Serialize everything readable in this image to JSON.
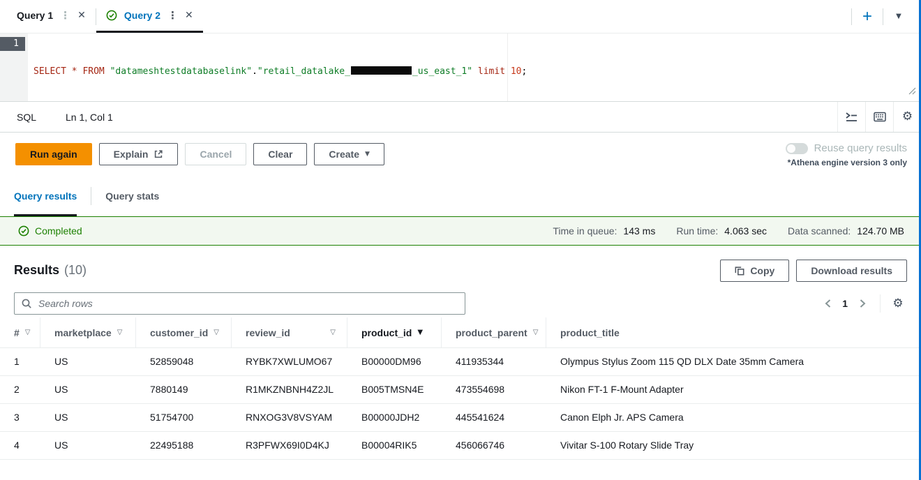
{
  "icons": {
    "kebab": "⋮",
    "close": "✕",
    "plus": "+",
    "caret_down": "▼",
    "gear": "⚙",
    "sort": "▽",
    "sort_active": "▼"
  },
  "colors": {
    "accent_blue": "#0073bb",
    "run_button_orange": "#f49000",
    "success_green": "#1d8102",
    "banner_background": "#f2f8f0",
    "panel_edge_blue": "#0972d3"
  },
  "query_tabs": [
    {
      "label": "Query 1",
      "active": false
    },
    {
      "label": "Query 2",
      "active": true,
      "status": "completed"
    }
  ],
  "editor": {
    "line_number": "1",
    "sql_segments": [
      {
        "text": "SELECT * FROM ",
        "type": "keyword"
      },
      {
        "text": "\"datameshtestdatabaselink\"",
        "type": "string"
      },
      {
        "text": ".",
        "type": "plain"
      },
      {
        "text": "\"retail_datalake_",
        "type": "string"
      },
      {
        "text": "",
        "type": "redacted"
      },
      {
        "text": "_us_east_1\"",
        "type": "string"
      },
      {
        "text": " ",
        "type": "plain"
      },
      {
        "text": "limit",
        "type": "keyword"
      },
      {
        "text": " ",
        "type": "plain"
      },
      {
        "text": "10",
        "type": "number"
      },
      {
        "text": ";",
        "type": "plain"
      }
    ]
  },
  "status_bar": {
    "mode": "SQL",
    "cursor": "Ln 1, Col 1"
  },
  "actions": {
    "run_again": "Run again",
    "explain": "Explain",
    "cancel": "Cancel",
    "clear": "Clear",
    "create": "Create",
    "reuse_toggle_label": "Reuse query results",
    "engine_note": "*Athena engine version 3 only"
  },
  "result_tabs": [
    {
      "label": "Query results",
      "active": true
    },
    {
      "label": "Query stats",
      "active": false
    }
  ],
  "banner": {
    "status": "Completed",
    "metrics": [
      {
        "label": "Time in queue:",
        "value": "143 ms"
      },
      {
        "label": "Run time:",
        "value": "4.063 sec"
      },
      {
        "label": "Data scanned:",
        "value": "124.70 MB"
      }
    ]
  },
  "results_header": {
    "title": "Results",
    "count": "(10)",
    "copy_label": "Copy",
    "download_label": "Download results"
  },
  "search": {
    "placeholder": "Search rows"
  },
  "pagination": {
    "page": "1"
  },
  "table": {
    "columns": [
      {
        "key": "num",
        "label": "#",
        "sortable": true,
        "active": false,
        "sort_far": false
      },
      {
        "key": "marketplace",
        "label": "marketplace",
        "sortable": true,
        "active": false,
        "sort_far": false
      },
      {
        "key": "customer_id",
        "label": "customer_id",
        "sortable": true,
        "active": false,
        "sort_far": false
      },
      {
        "key": "review_id",
        "label": "review_id",
        "sortable": true,
        "active": false,
        "sort_far": true
      },
      {
        "key": "product_id",
        "label": "product_id",
        "sortable": true,
        "active": true,
        "sort_far": false
      },
      {
        "key": "product_parent",
        "label": "product_parent",
        "sortable": true,
        "active": false,
        "sort_far": false
      },
      {
        "key": "product_title",
        "label": "product_title",
        "sortable": false,
        "active": false,
        "sort_far": false
      }
    ],
    "rows": [
      [
        "1",
        "US",
        "52859048",
        "RYBK7XWLUMO67",
        "B00000DM96",
        "411935344",
        "Olympus Stylus Zoom 115 QD DLX Date 35mm Camera"
      ],
      [
        "2",
        "US",
        "7880149",
        "R1MKZNBNH4Z2JL",
        "B005TMSN4E",
        "473554698",
        "Nikon FT-1 F-Mount Adapter"
      ],
      [
        "3",
        "US",
        "51754700",
        "RNXOG3V8VSYAM",
        "B00000JDH2",
        "445541624",
        "Canon Elph Jr. APS Camera"
      ],
      [
        "4",
        "US",
        "22495188",
        "R3PFWX69I0D4KJ",
        "B00004RIK5",
        "456066746",
        "Vivitar S-100 Rotary Slide Tray"
      ]
    ]
  }
}
